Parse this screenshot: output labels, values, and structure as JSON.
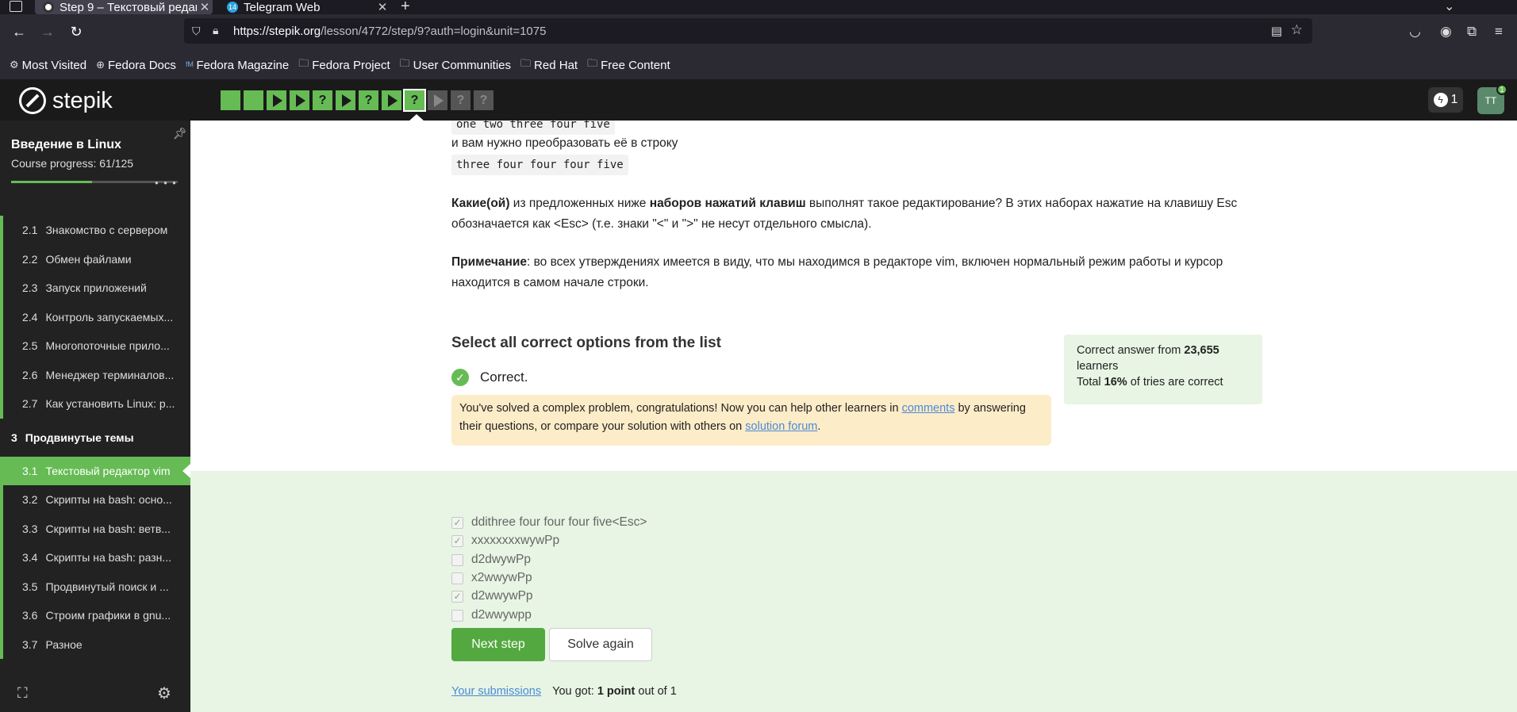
{
  "browser": {
    "tabs": [
      {
        "title": "Step 9 – Текстовый редак",
        "favicon": "stepik-icon"
      },
      {
        "title": "Telegram Web",
        "favicon": "telegram-icon",
        "badge": "14"
      }
    ],
    "url_host": "https://stepik.org",
    "url_rest": "/lesson/4772/step/9?auth=login&unit=1075",
    "bookmarks": [
      {
        "label": "Most Visited",
        "icon": "gear-icon"
      },
      {
        "label": "Fedora Docs",
        "icon": "globe-icon"
      },
      {
        "label": "Fedora Magazine",
        "icon": "fm-icon"
      },
      {
        "label": "Fedora Project",
        "icon": "folder-icon"
      },
      {
        "label": "User Communities",
        "icon": "folder-icon"
      },
      {
        "label": "Red Hat",
        "icon": "folder-icon"
      },
      {
        "label": "Free Content",
        "icon": "folder-icon"
      }
    ]
  },
  "header": {
    "logo": "stepik",
    "energy": "1",
    "avatar": "TT",
    "avatar_badge": "1",
    "steps": [
      {
        "type": "square",
        "state": "green"
      },
      {
        "type": "square",
        "state": "green"
      },
      {
        "type": "play",
        "state": "green"
      },
      {
        "type": "play",
        "state": "green"
      },
      {
        "type": "quiz",
        "state": "green",
        "label": "?"
      },
      {
        "type": "play",
        "state": "green"
      },
      {
        "type": "quiz",
        "state": "green",
        "label": "?"
      },
      {
        "type": "play",
        "state": "green"
      },
      {
        "type": "quiz",
        "state": "current",
        "label": "?"
      },
      {
        "type": "play",
        "state": "grey"
      },
      {
        "type": "quiz",
        "state": "grey",
        "label": "?"
      },
      {
        "type": "quiz",
        "state": "grey",
        "label": "?"
      }
    ]
  },
  "sidebar": {
    "course_title": "Введение в Linux",
    "progress_label": "Course progress:  61/125",
    "progress_fraction": 0.488,
    "items": [
      {
        "num": "2.1",
        "label": "Знакомство с сервером"
      },
      {
        "num": "2.2",
        "label": "Обмен файлами"
      },
      {
        "num": "2.3",
        "label": "Запуск приложений"
      },
      {
        "num": "2.4",
        "label": "Контроль запускаемых..."
      },
      {
        "num": "2.5",
        "label": "Многопоточные прило..."
      },
      {
        "num": "2.6",
        "label": "Менеджер терминалов..."
      },
      {
        "num": "2.7",
        "label": "Как установить Linux: р..."
      }
    ],
    "section": {
      "num": "3",
      "label": "Продвинутые темы"
    },
    "items2": [
      {
        "num": "3.1",
        "label": "Текстовый редактор vim",
        "active": true
      },
      {
        "num": "3.2",
        "label": "Скрипты на bash: осно..."
      },
      {
        "num": "3.3",
        "label": "Скрипты на bash: ветв..."
      },
      {
        "num": "3.4",
        "label": "Скрипты на bash: разн..."
      },
      {
        "num": "3.5",
        "label": "Продвинутый поиск и ..."
      },
      {
        "num": "3.6",
        "label": "Строим графики в gnu..."
      },
      {
        "num": "3.7",
        "label": "Разное"
      }
    ]
  },
  "lesson": {
    "code1": "one two three four five",
    "line2": "и вам нужно преобразовать её в строку",
    "code2": "three four four four five",
    "q_bold1": "Какие(ой)",
    "q_text1": " из предложенных ниже ",
    "q_bold2": "наборов нажатий клавиш",
    "q_text2": " выполнят такое редактирование? В этих наборах нажатие на клавишу Esc обозначается как <Esc> (т.е. знаки \"<\" и \">\" не несут отдельного смысла).",
    "note_bold": "Примечание",
    "note_text": ": во всех утверждениях имеется в виду, что мы находимся в редакторе vim, включен нормальный режим работы и курсор находится в самом начале строки."
  },
  "quiz": {
    "title": "Select all correct options from the list",
    "status": "Correct.",
    "congrats_1": "You've solved a complex problem, congratulations! Now you can help other learners in ",
    "comments_link": "comments",
    "congrats_2": " by answering their questions, or compare your solution with others on ",
    "forum_link": "solution forum",
    "congrats_3": ".",
    "stats_1": "Correct answer from ",
    "stats_learners_count": "23,655",
    "stats_2": " learners",
    "stats_3": "Total ",
    "stats_percent": "16%",
    "stats_4": " of tries are correct",
    "options": [
      {
        "label": "ddithree four four four five<Esc>",
        "checked": true
      },
      {
        "label": "xxxxxxxxwywPp",
        "checked": true
      },
      {
        "label": "d2dwywPp",
        "checked": false
      },
      {
        "label": "x2wwywPp",
        "checked": false
      },
      {
        "label": "d2wwywPp",
        "checked": true
      },
      {
        "label": "d2wwywpp",
        "checked": false
      }
    ],
    "next_button": "Next step",
    "again_button": "Solve again",
    "submissions_link": "Your submissions",
    "score_1": "You got: ",
    "score_bold": "1 point",
    "score_2": " out of 1"
  }
}
